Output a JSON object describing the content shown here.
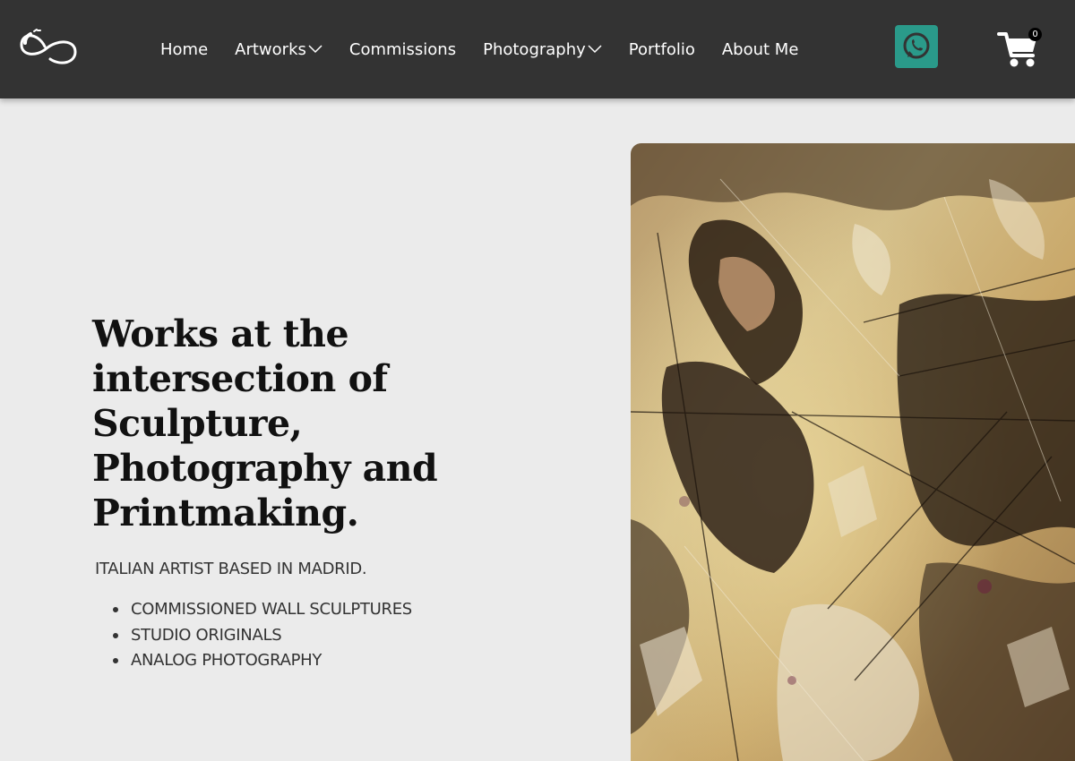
{
  "header": {
    "logo_icon": "infinity-swirl-logo",
    "nav": [
      {
        "label": "Home",
        "has_dropdown": false
      },
      {
        "label": "Artworks",
        "has_dropdown": true
      },
      {
        "label": "Commissions",
        "has_dropdown": false
      },
      {
        "label": "Photography",
        "has_dropdown": true
      },
      {
        "label": "Portfolio",
        "has_dropdown": false
      },
      {
        "label": "About Me",
        "has_dropdown": false
      }
    ],
    "whatsapp_icon": "whatsapp-icon",
    "whatsapp_color": "#2a9a8a",
    "cart_icon": "shopping-cart-icon",
    "cart_count": "0"
  },
  "hero": {
    "title": "Works at the intersection of Sculpture, Photography and Printmaking.",
    "tagline": "ITALIAN ARTIST BASED IN MADRID.",
    "bullets": [
      "COMMISSIONED WALL SCULPTURES",
      "STUDIO ORIGINALS",
      "ANALOG PHOTOGRAPHY"
    ],
    "image_description_icon": "artwork-image"
  },
  "colors": {
    "header_bg": "#333333",
    "page_bg": "#ebebeb",
    "text_dark": "#111111"
  }
}
